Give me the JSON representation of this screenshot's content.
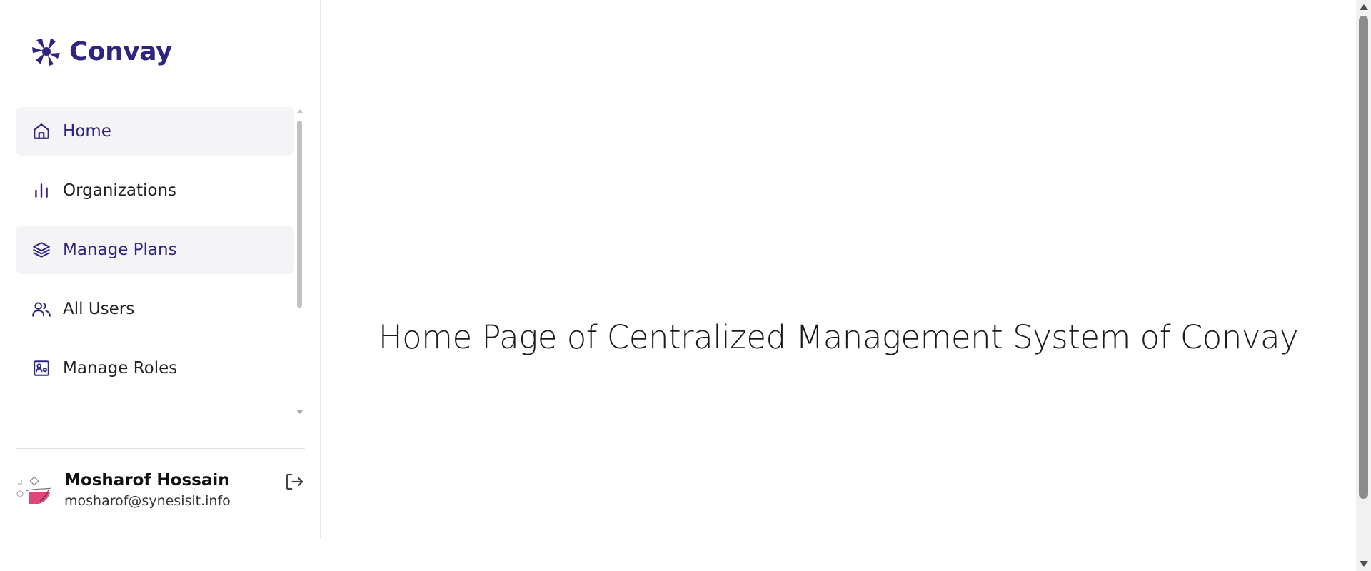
{
  "app": {
    "brand": "Convay",
    "accent_color": "#2e2580"
  },
  "sidebar": {
    "items": [
      {
        "label": "Home",
        "icon": "home-icon",
        "state": "active"
      },
      {
        "label": "Organizations",
        "icon": "bar-chart-icon",
        "state": "default"
      },
      {
        "label": "Manage Plans",
        "icon": "layers-icon",
        "state": "hover"
      },
      {
        "label": "All Users",
        "icon": "users-icon",
        "state": "default"
      },
      {
        "label": "Manage Roles",
        "icon": "id-card-icon",
        "state": "default"
      }
    ]
  },
  "user": {
    "name": "Mosharof Hossain",
    "email": "mosharof@synesisit.info",
    "logout_icon": "logout-icon"
  },
  "main": {
    "heading": "Home Page of Centralized Management System of Convay"
  }
}
